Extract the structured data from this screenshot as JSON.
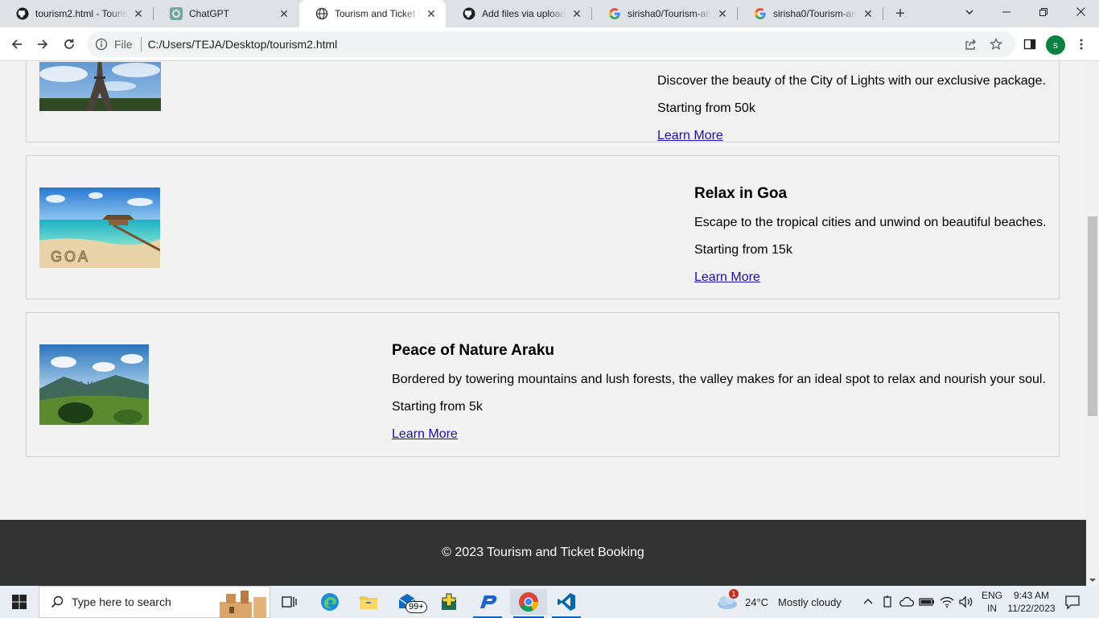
{
  "browser": {
    "tabs": [
      {
        "title": "tourism2.html - Touris",
        "icon": "github-icon"
      },
      {
        "title": "ChatGPT",
        "icon": "chatgpt-icon"
      },
      {
        "title": "Tourism and Ticket Bo",
        "icon": "globe-icon",
        "active": true
      },
      {
        "title": "Add files via upload ·",
        "icon": "github-icon"
      },
      {
        "title": "sirisha0/Tourism-and·",
        "icon": "google-icon"
      },
      {
        "title": "sirisha0/Tourism-and·",
        "icon": "google-icon"
      }
    ],
    "new_tab": "+",
    "address": {
      "scheme_label": "File",
      "url": "C:/Users/TEJA/Desktop/tourism2.html"
    },
    "profile_initial": "s"
  },
  "page": {
    "cards": [
      {
        "title": "",
        "image": "Eiffel Tower",
        "description": "Discover the beauty of the City of Lights with our exclusive package.",
        "price": "Starting from 50k",
        "link": "Learn More"
      },
      {
        "title": "Relax in Goa",
        "image": "GOA",
        "description": "Escape to the tropical cities and unwind on beautiful beaches.",
        "price": "Starting from 15k",
        "link": "Learn More"
      },
      {
        "title": "Peace of Nature Araku",
        "image": "ARAKU",
        "description": "Bordered by towering mountains and lush forests, the valley makes for an ideal spot to relax and nourish your soul.",
        "price": "Starting from 5k",
        "link": "Learn More"
      }
    ],
    "footer": "© 2023 Tourism and Ticket Booking"
  },
  "taskbar": {
    "search_placeholder": "Type here to search",
    "mail_badge": "99+",
    "weather": {
      "temp": "24°C",
      "condition": "Mostly cloudy",
      "alert": "1"
    },
    "language": {
      "lang": "ENG",
      "region": "IN"
    },
    "clock": {
      "time": "9:43 AM",
      "date": "11/22/2023"
    }
  },
  "colors": {
    "link": "#1a0dab",
    "footer_bg": "#333333",
    "page_bg": "#f2f2f2"
  }
}
